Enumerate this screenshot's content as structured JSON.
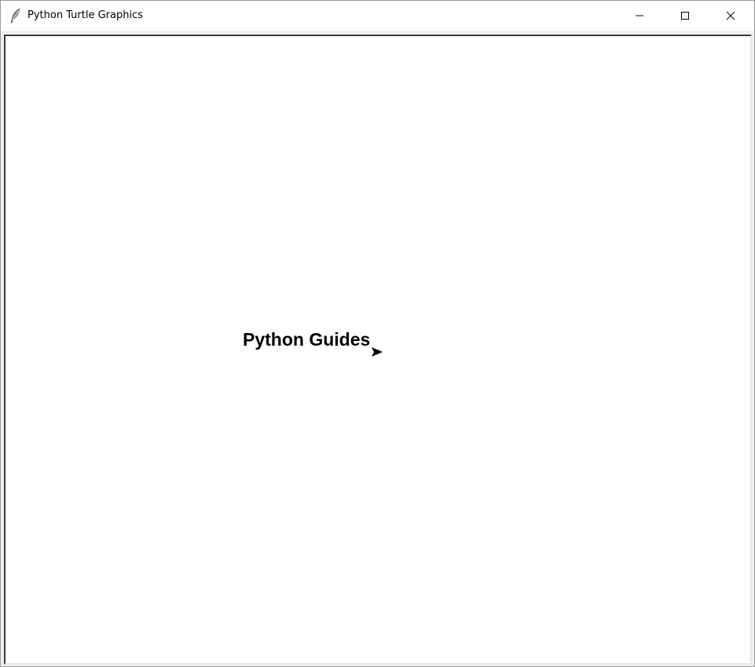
{
  "window": {
    "title": "Python Turtle Graphics",
    "icon": "feather-icon",
    "controls": {
      "minimize": "minimize-icon",
      "maximize": "maximize-icon",
      "close": "close-icon"
    }
  },
  "canvas": {
    "background": "#ffffff",
    "text": "Python Guides",
    "text_color": "#000000",
    "turtle_shape": "arrow-icon",
    "turtle_color": "#000000"
  }
}
